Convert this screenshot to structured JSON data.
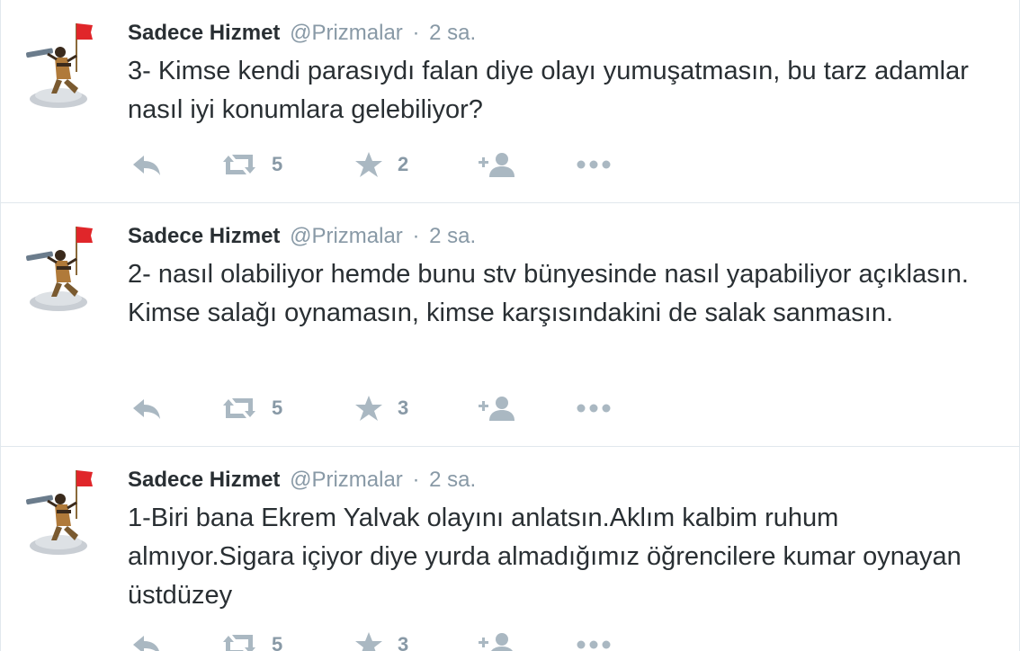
{
  "tweets": [
    {
      "fullname": "Sadece Hizmet",
      "username": "@Prizmalar",
      "separator": "·",
      "time": "2 sa.",
      "text": "3- Kimse kendi parasıydı falan diye olayı yumuşatmasın, bu tarz adamlar nasıl iyi konumlara gelebiliyor?",
      "retweets": "5",
      "favorites": "2"
    },
    {
      "fullname": "Sadece Hizmet",
      "username": "@Prizmalar",
      "separator": "·",
      "time": "2 sa.",
      "text": "2- nasıl olabiliyor hemde bunu stv bünyesinde nasıl yapabiliyor açıklasın. Kimse salağı oynamasın, kimse karşısındakini de salak sanmasın.",
      "retweets": "5",
      "favorites": "3"
    },
    {
      "fullname": "Sadece Hizmet",
      "username": "@Prizmalar",
      "separator": "·",
      "time": "2 sa.",
      "text": "1-Biri bana Ekrem Yalvak olayını anlatsın.Aklım kalbim ruhum almıyor.Sigara içiyor diye yurda almadığımız öğrencilere kumar oynayan üstdüzey",
      "retweets": "5",
      "favorites": "3"
    }
  ],
  "icons": {
    "reply": "reply-icon",
    "retweet": "retweet-icon",
    "favorite": "star-icon",
    "follow": "follow-icon",
    "more": "more-icon",
    "avatar": "explorer-with-flag-avatar"
  },
  "colors": {
    "name": "#292f33",
    "meta": "#8899a6",
    "action_icon": "#aab8c2",
    "divider": "#e1e8ed",
    "flag": "#e0262a"
  }
}
